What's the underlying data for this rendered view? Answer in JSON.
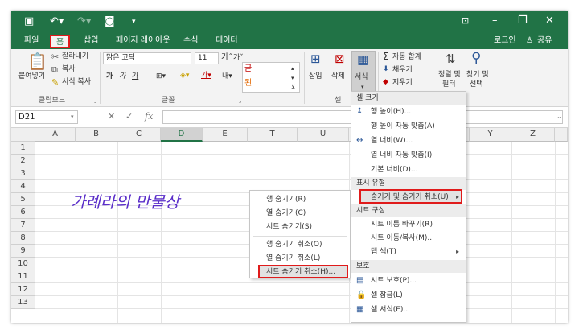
{
  "tabs": {
    "file": "파일",
    "home": "홈",
    "insert": "삽입",
    "page_layout": "페이지 레이아웃",
    "formulas": "수식",
    "data": "데이터",
    "login": "로그인",
    "share": "공유"
  },
  "ribbon": {
    "paste": "붙여넣기",
    "cut": "잘라내기",
    "copy": "복사",
    "format_painter": "서식 복사",
    "clipboard_label": "클립보드",
    "font_name": "맑은 고딕",
    "font_size": "11",
    "font_label": "글꼴",
    "bold": "가",
    "italic": "가",
    "underline": "가",
    "cell_label": "셀",
    "insert": "삽입",
    "delete": "삭제",
    "format": "서식",
    "autosum": "자동 합계",
    "fill": "채우기",
    "clear": "지우기",
    "sort_filter_1": "정렬 및",
    "sort_filter_2": "필터",
    "find_select_1": "찾기 및",
    "find_select_2": "선택"
  },
  "formula_bar": {
    "name_box": "D21",
    "fx": "fx"
  },
  "grid": {
    "columns": [
      "A",
      "B",
      "C",
      "D",
      "E",
      "T",
      "U",
      "Y",
      "Z"
    ],
    "selected_column": "D",
    "rows": [
      "1",
      "2",
      "3",
      "4",
      "5",
      "6",
      "7",
      "8",
      "9",
      "10",
      "11",
      "12",
      "13"
    ]
  },
  "handwriting": "가례라의 만물상",
  "format_menu": {
    "cell_size_header": "셀 크기",
    "row_height": "행 높이(H)...",
    "autofit_row": "행 높이 자동 맞춤(A)",
    "col_width": "열 너비(W)...",
    "autofit_col": "열 너비 자동 맞춤(I)",
    "default_width": "기본 너비(D)...",
    "visibility_header": "표시 유형",
    "hide_unhide": "숨기기 및 숨기기 취소(U)",
    "organize_header": "시트 구성",
    "rename_sheet": "시트 이름 바꾸기(R)",
    "move_copy_sheet": "시트 이동/복사(M)...",
    "tab_color": "탭 색(T)",
    "protection_header": "보호",
    "protect_sheet": "시트 보호(P)...",
    "lock_cell": "셀 잠금(L)",
    "format_cells": "셀 서식(E)..."
  },
  "hide_submenu": {
    "hide_rows": "행 숨기기(R)",
    "hide_columns": "열 숨기기(C)",
    "hide_sheet": "시트 숨기기(S)",
    "unhide_rows": "행 숨기기 취소(O)",
    "unhide_columns": "열 숨기기 취소(L)",
    "unhide_sheet": "시트 숨기기 취소(H)..."
  },
  "colors": {
    "excel_green": "#217346",
    "highlight_red": "#e01b1b",
    "handwriting_purple": "#5a2ec9"
  }
}
